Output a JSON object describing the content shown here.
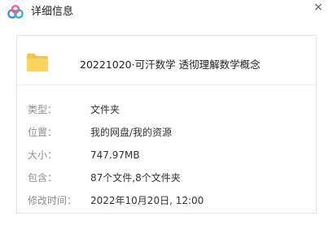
{
  "window": {
    "title": "详细信息",
    "close_glyph": "×"
  },
  "file": {
    "name": "20221020·可汗数学 透彻理解数学概念",
    "icon": "folder-icon",
    "icon_color": "#fdd55e"
  },
  "details": [
    {
      "label": "类型：",
      "value": "文件夹"
    },
    {
      "label": "位置：",
      "value": "我的网盘/我的资源"
    },
    {
      "label": "大小：",
      "value": "747.97MB"
    },
    {
      "label": "包含：",
      "value": "87个文件,8个文件夹"
    },
    {
      "label": "修改时间：",
      "value": "2022年10月20日, 12:00"
    }
  ],
  "colors": {
    "logo_blue": "#3d83f7",
    "logo_pink": "#f25f8c",
    "logo_teal": "#2bb5c9"
  }
}
